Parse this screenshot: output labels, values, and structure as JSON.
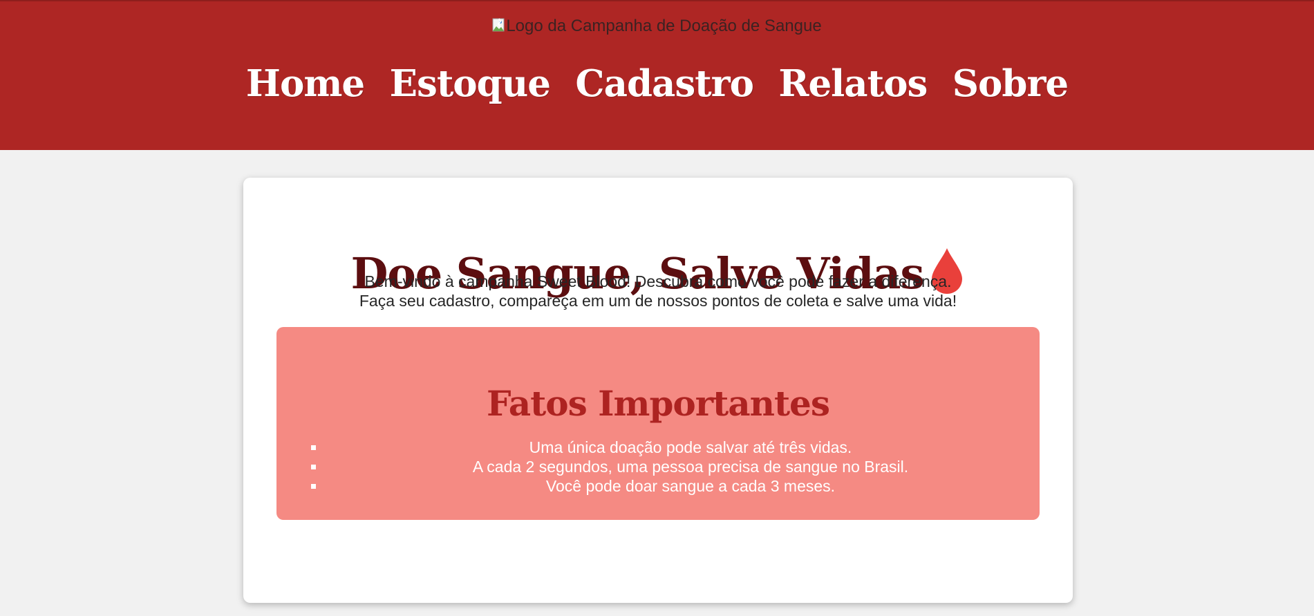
{
  "header": {
    "logo_alt": "Logo da Campanha de Doação de Sangue",
    "nav": [
      "Home",
      "Estoque",
      "Cadastro",
      "Relatos",
      "Sobre"
    ]
  },
  "hero": {
    "title": "Doe Sangue, Salve Vidas",
    "icon": "blood-drop-icon",
    "intro_line_1": "Bem-vindo à campanha Sweet Blood! Descubra como você pode fazer a diferença.",
    "intro_line_2": "Faça seu cadastro, compareça em um de nossos pontos de coleta e salve uma vida!"
  },
  "facts": {
    "title": "Fatos Importantes",
    "items": [
      "Uma única doação pode salvar até três vidas.",
      "A cada 2 segundos, uma pessoa precisa de sangue no Brasil.",
      "Você pode doar sangue a cada 3 meses."
    ]
  },
  "colors": {
    "header_bg": "#ae2624",
    "page_bg": "#f1f1f1",
    "title_color": "#5c0e10",
    "facts_bg": "#f58a83",
    "facts_title": "#ad2321",
    "drop_color": "#e9403b"
  }
}
